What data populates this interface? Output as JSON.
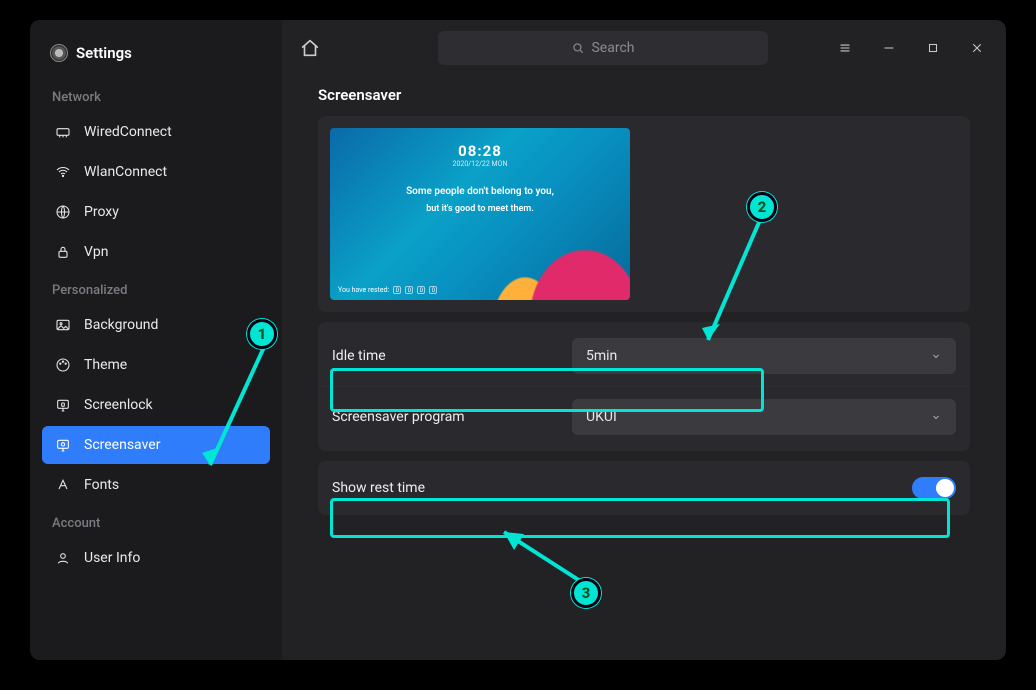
{
  "app": {
    "title": "Settings"
  },
  "search": {
    "placeholder": "Search"
  },
  "sidebar": {
    "groups": [
      {
        "label": "Network",
        "items": [
          {
            "label": "WiredConnect"
          },
          {
            "label": "WlanConnect"
          },
          {
            "label": "Proxy"
          },
          {
            "label": "Vpn"
          }
        ]
      },
      {
        "label": "Personalized",
        "items": [
          {
            "label": "Background"
          },
          {
            "label": "Theme"
          },
          {
            "label": "Screenlock"
          },
          {
            "label": "Screensaver"
          },
          {
            "label": "Fonts"
          }
        ]
      },
      {
        "label": "Account",
        "items": [
          {
            "label": "User Info"
          }
        ]
      }
    ]
  },
  "page": {
    "title": "Screensaver",
    "preview": {
      "clock": "08:28",
      "date": "2020/12/22 MON",
      "line1": "Some people don't belong to you,",
      "line2": "but it's good to meet them.",
      "rest_label": "You have rested:",
      "rest_digits": [
        "0",
        "0",
        "0",
        "0"
      ]
    },
    "rows": {
      "idle_time": {
        "label": "Idle time",
        "value": "5min"
      },
      "program": {
        "label": "Screensaver program",
        "value": "UKUI"
      },
      "show_rest": {
        "label": "Show rest time",
        "on": true
      }
    }
  },
  "annotations": {
    "b1": "1",
    "b2": "2",
    "b3": "3"
  }
}
